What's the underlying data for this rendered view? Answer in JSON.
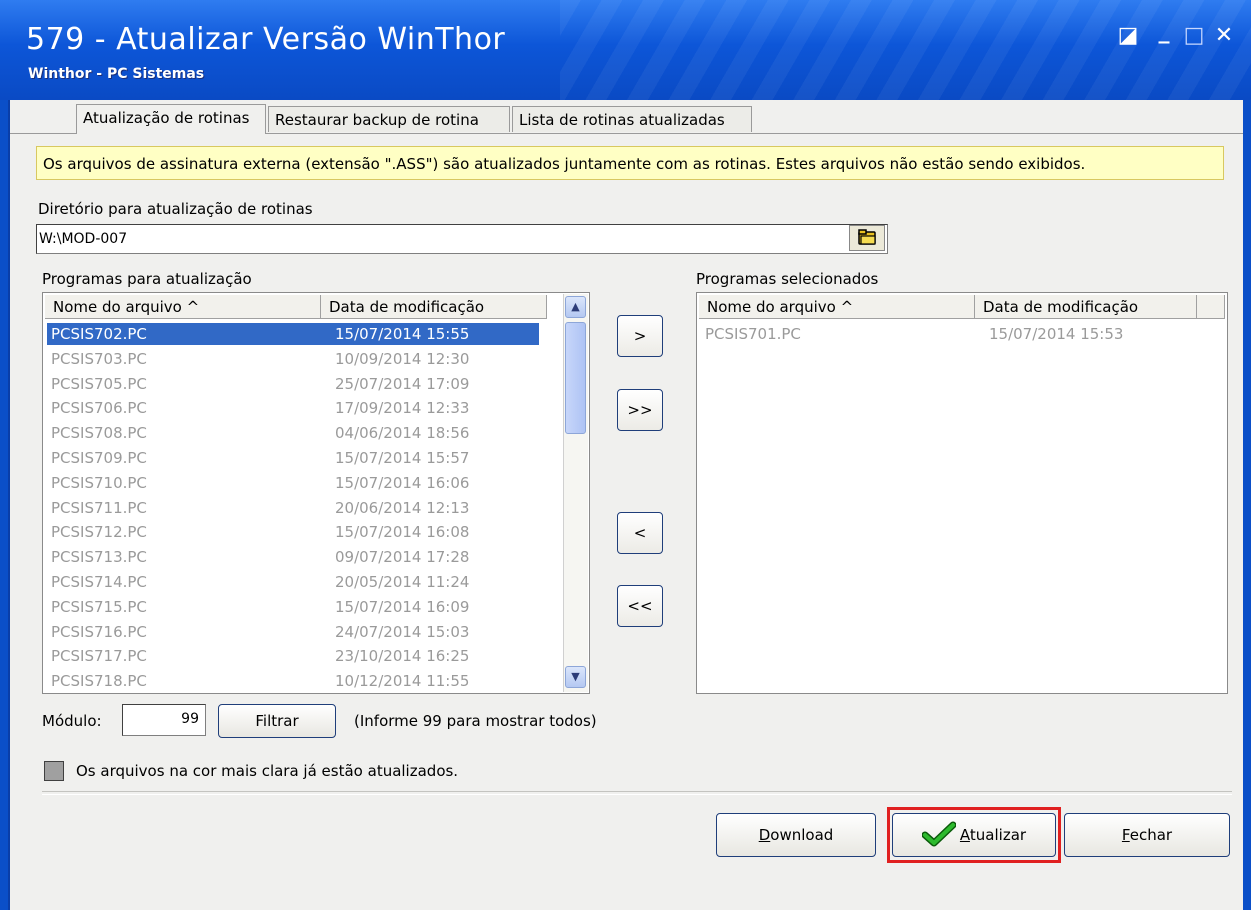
{
  "window": {
    "title": "579 - Atualizar Versão WinThor",
    "subtitle": "Winthor - PC Sistemas",
    "controls": {
      "help": "◪",
      "minimize": "_",
      "maximize": "□",
      "close": "✕"
    }
  },
  "tabs": [
    {
      "label": "Atualização de rotinas",
      "active": true
    },
    {
      "label": "Restaurar backup de rotina",
      "active": false
    },
    {
      "label": "Lista de rotinas atualizadas",
      "active": false
    }
  ],
  "info_message": "Os arquivos de assinatura externa (extensão \".ASS\") são atualizados juntamente com as rotinas. Estes arquivos não estão sendo exibidos.",
  "directory": {
    "label": "Diretório para atualização de rotinas",
    "value": "W:\\MOD-007"
  },
  "available": {
    "label": "Programas para atualização",
    "columns": [
      "Nome do arquivo ^",
      "Data de modificação"
    ],
    "rows": [
      {
        "name": "PCSIS702.PC",
        "date": "15/07/2014 15:55",
        "selected": true
      },
      {
        "name": "PCSIS703.PC",
        "date": "10/09/2014 12:30"
      },
      {
        "name": "PCSIS705.PC",
        "date": "25/07/2014 17:09"
      },
      {
        "name": "PCSIS706.PC",
        "date": "17/09/2014 12:33"
      },
      {
        "name": "PCSIS708.PC",
        "date": "04/06/2014 18:56"
      },
      {
        "name": "PCSIS709.PC",
        "date": "15/07/2014 15:57"
      },
      {
        "name": "PCSIS710.PC",
        "date": "15/07/2014 16:06"
      },
      {
        "name": "PCSIS711.PC",
        "date": "20/06/2014 12:13"
      },
      {
        "name": "PCSIS712.PC",
        "date": "15/07/2014 16:08"
      },
      {
        "name": "PCSIS713.PC",
        "date": "09/07/2014 17:28"
      },
      {
        "name": "PCSIS714.PC",
        "date": "20/05/2014 11:24"
      },
      {
        "name": "PCSIS715.PC",
        "date": "15/07/2014 16:09"
      },
      {
        "name": "PCSIS716.PC",
        "date": "24/07/2014 15:03"
      },
      {
        "name": "PCSIS717.PC",
        "date": "23/10/2014 16:25"
      },
      {
        "name": "PCSIS718.PC",
        "date": "10/12/2014 11:55"
      }
    ]
  },
  "selected": {
    "label": "Programas selecionados",
    "columns": [
      "Nome do arquivo ^",
      "Data de modificação"
    ],
    "rows": [
      {
        "name": "PCSIS701.PC",
        "date": "15/07/2014 15:53"
      }
    ]
  },
  "move_buttons": {
    "add_one": ">",
    "add_all": ">>",
    "remove_one": "<",
    "remove_all": "<<"
  },
  "modulo": {
    "label": "Módulo:",
    "value": "99",
    "filter_button": "Filtrar",
    "hint": "(Informe 99 para mostrar todos)"
  },
  "legend_text": "Os arquivos na cor mais clara já estão atualizados.",
  "footer": {
    "download": {
      "accel": "D",
      "rest": "ownload"
    },
    "atualizar": {
      "accel": "A",
      "rest": "tualizar"
    },
    "fechar": {
      "accel": "F",
      "rest": "echar"
    }
  },
  "colors": {
    "titlebar": "#0d56d8",
    "selection": "#3169c6",
    "info_bg": "#ffffc4",
    "highlight": "#e02020",
    "check": "#1a9a1a"
  }
}
